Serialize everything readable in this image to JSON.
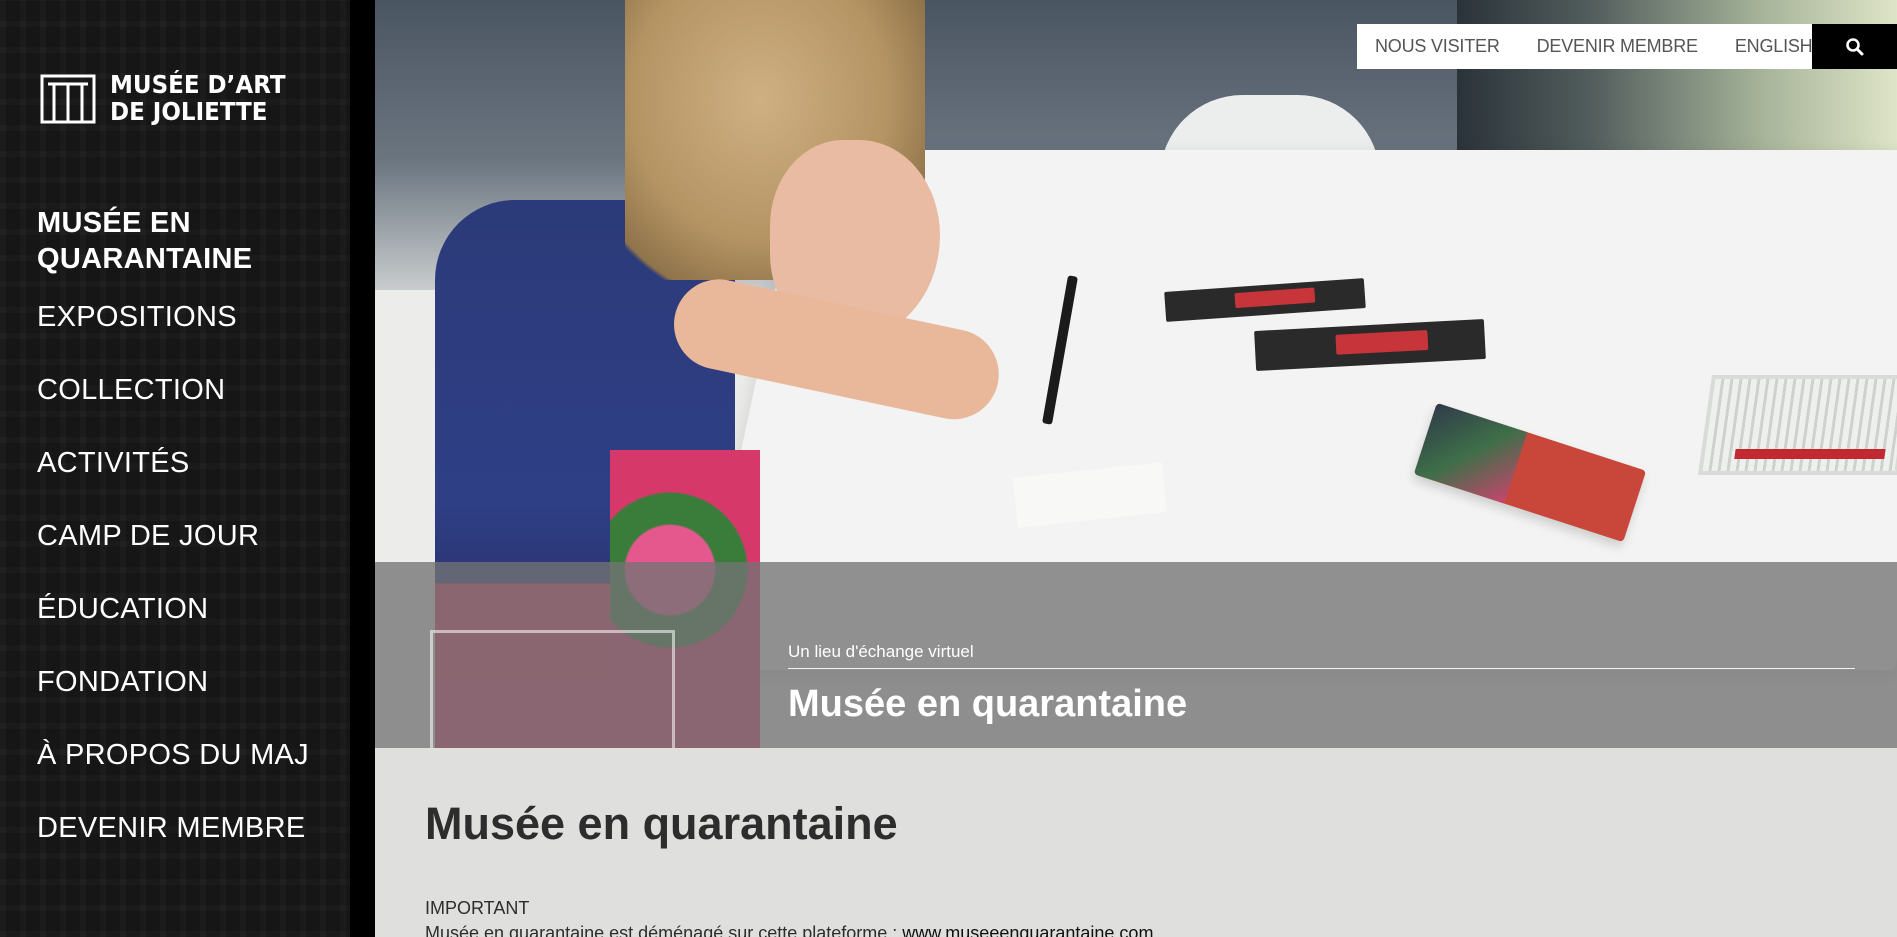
{
  "logo": {
    "line1": "MUSÉE D’ART",
    "line2": "DE JOLIETTE",
    "icon": "museum-logo-mark"
  },
  "sidebar": {
    "items": [
      {
        "label_line1": "MUSÉE EN",
        "label_line2": "QUARANTAINE",
        "active": true
      },
      {
        "label": "EXPOSITIONS"
      },
      {
        "label": "COLLECTION"
      },
      {
        "label": "ACTIVITÉS"
      },
      {
        "label": "CAMP DE JOUR"
      },
      {
        "label": "ÉDUCATION"
      },
      {
        "label": "FONDATION"
      },
      {
        "label": "À PROPOS DU MAJ"
      },
      {
        "label": "DEVENIR MEMBRE"
      }
    ]
  },
  "topbar": {
    "links": [
      "NOUS VISITER",
      "DEVENIR MEMBRE",
      "ENGLISH"
    ],
    "search_icon": "search-icon"
  },
  "hero": {
    "kicker": "Un lieu d'échange virtuel",
    "title": "Musée en quarantaine"
  },
  "content": {
    "title": "Musée en quarantaine",
    "important_label": "IMPORTANT",
    "important_text": "Musée en quarantaine est déménagé sur cette plateforme : ",
    "important_link": "www.museeenquarantaine.com"
  },
  "colors": {
    "sidebar_bg": "#161616",
    "content_bg": "#dfe0dd",
    "overlay": "#737373"
  }
}
